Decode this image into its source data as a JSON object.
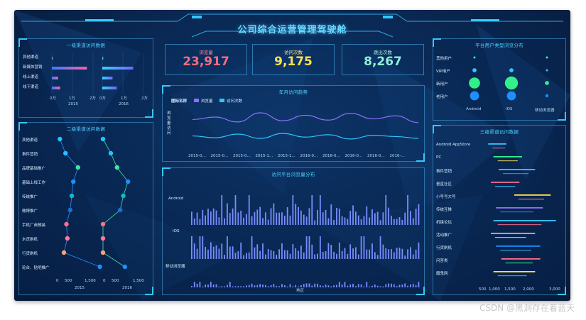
{
  "title": "公司综合运营管理驾驶舱",
  "kpis": [
    {
      "label": "浏览量",
      "value": "23,917",
      "color": "#ff6b7d"
    },
    {
      "label": "访问次数",
      "value": "9,175",
      "color": "#ffe14d"
    },
    {
      "label": "跳出次数",
      "value": "8,267",
      "color": "#8ff0d6"
    }
  ],
  "panels": {
    "primary_source": {
      "title": "一级渠道访问数据",
      "rows": [
        "其他渠道",
        "新媒体营销",
        "线上渠道",
        "线下渠道"
      ],
      "ticks_2015": [
        "0万",
        "1万",
        "2万"
      ],
      "ticks_2016": [
        "0万",
        "1万",
        "2万"
      ],
      "year_2015": "2015",
      "year_2016": "2016"
    },
    "secondary_source": {
      "title": "二级渠道访问数据",
      "rows": [
        "其他渠道",
        "事件营销",
        "品牌基础推广",
        "基础上线工作",
        "传统推广",
        "微博推广",
        "手机厂商预装",
        "水货刷机",
        "行货刷机",
        "轮台、贴吧推广"
      ],
      "ticks_2015": [
        "0",
        "500",
        "1,500"
      ],
      "ticks_2016": [
        "0",
        "500",
        "1,500"
      ],
      "year_2015": "2015",
      "year_2016": "2016"
    },
    "trend": {
      "title": "年月访问趋势",
      "legend_prefix": "图标名称",
      "legend_pv": "浏览量",
      "legend_visits": "访问次数",
      "ylabel": "浏览量 访问",
      "x_ticks": [
        "2015-0...",
        "2015-0...",
        "2015-0...",
        "2015-1...",
        "2015-1...",
        "2016-0...",
        "2016-0...",
        "2016-0...",
        "2016-0...",
        "2016-..."
      ]
    },
    "platform": {
      "title": "访问平台浏览量分布",
      "rows": [
        "Android",
        "IOS",
        "移动浏览器"
      ],
      "xlabel": "地区"
    },
    "user_type": {
      "title": "平台用户类型浏览分布",
      "rows": [
        "其他用户",
        "VIP用户",
        "新用户",
        "老用户"
      ],
      "cols": [
        "Android",
        "IOS",
        "移动浏览器"
      ]
    },
    "tertiary_source": {
      "title": "三级渠道访问数据",
      "rows": [
        "Android AppStore",
        "PC",
        "事件营销",
        "垂直社区",
        "小号号大号",
        "传统互推",
        "机锋论坛",
        "活动推广",
        "行货刷机",
        "问答类",
        "魔鬼网"
      ],
      "x_ticks": [
        "500",
        "1,000",
        "1,500",
        "2,000",
        "3,000"
      ]
    }
  },
  "watermark": "CSDN @黑洞存在着蓝天",
  "chart_data": [
    {
      "type": "bar",
      "title": "一级渠道访问数据",
      "categories": [
        "其他渠道",
        "新媒体营销",
        "线上渠道",
        "线下渠道"
      ],
      "series": [
        {
          "name": "2015",
          "values": [
            500,
            17000,
            3000,
            4000
          ]
        },
        {
          "name": "2016",
          "values": [
            300,
            15000,
            5000,
            7000
          ]
        }
      ],
      "xlim": [
        0,
        20000
      ]
    },
    {
      "type": "scatter",
      "title": "二级渠道访问数据",
      "categories": [
        "其他渠道",
        "事件营销",
        "品牌基础推广",
        "基础上线工作",
        "传统推广",
        "微博推广",
        "手机厂商预装",
        "水货刷机",
        "行货刷机",
        "轮台、贴吧推广"
      ],
      "series": [
        {
          "name": "2015",
          "values": [
            120,
            300,
            700,
            550,
            500,
            450,
            330,
            360,
            250,
            1400
          ]
        },
        {
          "name": "2016",
          "values": [
            0,
            250,
            450,
            800,
            650,
            550,
            0,
            0,
            0,
            700
          ]
        }
      ],
      "xlim": [
        0,
        1500
      ]
    },
    {
      "type": "line",
      "title": "年月访问趋势",
      "x": [
        "2015-01",
        "2015-03",
        "2015-05",
        "2015-07",
        "2015-09",
        "2015-11",
        "2016-01",
        "2016-03",
        "2016-05",
        "2016-07",
        "2016-09"
      ],
      "series": [
        {
          "name": "浏览量",
          "values": [
            5200,
            5600,
            4800,
            6300,
            5000,
            5900,
            5100,
            6200,
            5300,
            5800,
            4700
          ]
        },
        {
          "name": "访问次数",
          "values": [
            2500,
            2200,
            2800,
            2100,
            2900,
            2300,
            2700,
            2000,
            2600,
            2400,
            2100
          ]
        }
      ]
    },
    {
      "type": "bar",
      "title": "访问平台浏览量分布",
      "rows": [
        "Android",
        "IOS",
        "移动浏览器"
      ],
      "row_max": [
        1.0,
        0.8,
        0.35
      ],
      "xlabel": "地区"
    },
    {
      "type": "scatter",
      "title": "平台用户类型浏览分布",
      "rows": [
        "其他用户",
        "VIP用户",
        "新用户",
        "老用户"
      ],
      "cols": [
        "Android",
        "IOS",
        "移动浏览器"
      ],
      "sizes": [
        [
          1,
          0,
          1
        ],
        [
          3,
          3,
          1
        ],
        [
          10,
          12,
          3
        ],
        [
          8,
          8,
          2
        ]
      ]
    },
    {
      "type": "bar",
      "title": "三级渠道访问数据",
      "categories": [
        "Android AppStore",
        "PC",
        "事件营销",
        "垂直社区",
        "小号号大号",
        "传统互推",
        "机锋论坛",
        "活动推广",
        "行货刷机",
        "问答类",
        "魔鬼网"
      ],
      "ranges": [
        [
          200,
          900
        ],
        [
          400,
          1500
        ],
        [
          600,
          2000
        ],
        [
          300,
          1400
        ],
        [
          1200,
          2600
        ],
        [
          500,
          2300
        ],
        [
          400,
          2800
        ],
        [
          300,
          2000
        ],
        [
          500,
          2200
        ],
        [
          700,
          2200
        ],
        [
          400,
          2000
        ]
      ],
      "xlim": [
        0,
        3000
      ]
    }
  ]
}
